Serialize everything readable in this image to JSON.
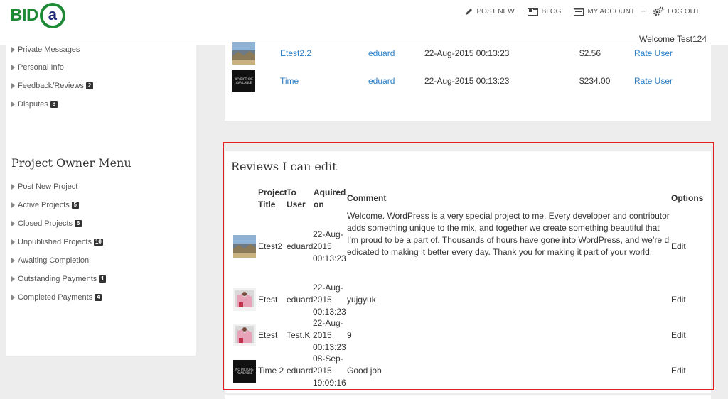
{
  "header": {
    "logo_text": "BID",
    "logo_letter": "a",
    "nav": [
      {
        "label": "POST NEW",
        "icon": "pencil-icon"
      },
      {
        "label": "BLOG",
        "icon": "newspaper-icon"
      },
      {
        "label": "MY ACCOUNT",
        "icon": "account-card-icon"
      },
      {
        "label": "LOG OUT",
        "icon": "gears-icon"
      }
    ],
    "nav_sep": "+",
    "welcome": "Welcome Test124"
  },
  "sidebar": {
    "account_items": [
      {
        "label": "Private Messages",
        "badge": null
      },
      {
        "label": "Personal Info",
        "badge": null
      },
      {
        "label": "Feedback/Reviews",
        "badge": "2"
      },
      {
        "label": "Disputes",
        "badge": "8"
      }
    ],
    "owner_menu_title": "Project Owner Menu",
    "owner_items": [
      {
        "label": "Post New Project",
        "badge": null
      },
      {
        "label": "Active Projects",
        "badge": "5"
      },
      {
        "label": "Closed Projects",
        "badge": "6"
      },
      {
        "label": "Unpublished Projects",
        "badge": "10"
      },
      {
        "label": "Awaiting Completion",
        "badge": null
      },
      {
        "label": "Outstanding Payments",
        "badge": "1"
      },
      {
        "label": "Completed Payments",
        "badge": "4"
      }
    ]
  },
  "top_table": {
    "rows": [
      {
        "thumb": "landscape",
        "title": "Etest2.2",
        "user": "eduard",
        "date": "22-Aug-2015 00:13:23",
        "price": "$2.56",
        "action": "Rate User"
      },
      {
        "thumb": "no-picture",
        "title": "Time",
        "user": "eduard",
        "date": "22-Aug-2015 00:13:23",
        "price": "$234.00",
        "action": "Rate User"
      }
    ]
  },
  "reviews": {
    "title": "Reviews I can edit",
    "headers": {
      "project_title": [
        "Project",
        "Title"
      ],
      "to_user": [
        "To",
        "User"
      ],
      "aquired_on": [
        "Aquired",
        "on"
      ],
      "comment": "Comment",
      "options": "Options"
    },
    "rows": [
      {
        "thumb": "landscape",
        "title": "Etest2",
        "user": "eduard",
        "date": [
          "22-Aug-",
          "2015",
          "00:13:23"
        ],
        "comment": [
          "Welcome. WordPress is a very special project to me. Every developer and contributor",
          "adds something unique to the mix, and together we create something beautiful that",
          "I’m proud to be a part of. Thousands of hours have gone into WordPress, and we’re d",
          "edicated to making it better every day. Thank you for making it part of your world."
        ],
        "option": "Edit"
      },
      {
        "thumb": "pink-photo",
        "title": "Etest",
        "user": "eduard",
        "date": [
          "22-Aug-",
          "2015",
          "00:13:23"
        ],
        "comment": [
          "yujgyuk"
        ],
        "option": "Edit"
      },
      {
        "thumb": "pink-photo",
        "title": "Etest",
        "user": "Test.K",
        "date": [
          "22-Aug-",
          "2015",
          "00:13:23"
        ],
        "comment": [
          "9"
        ],
        "option": "Edit"
      },
      {
        "thumb": "no-picture",
        "title": "Time 2",
        "user": "eduard",
        "date": [
          "08-Sep-",
          "2015",
          "19:09:16"
        ],
        "comment": [
          "Good job"
        ],
        "option": "Edit"
      }
    ],
    "no_picture_text": [
      "NO PICTURE",
      "AVAILABLE"
    ]
  },
  "colors": {
    "accent_green": "#1d8a36",
    "logo_navy": "#1e2a78",
    "link_blue": "#2a7ec7",
    "highlight_red": "#e02020"
  }
}
